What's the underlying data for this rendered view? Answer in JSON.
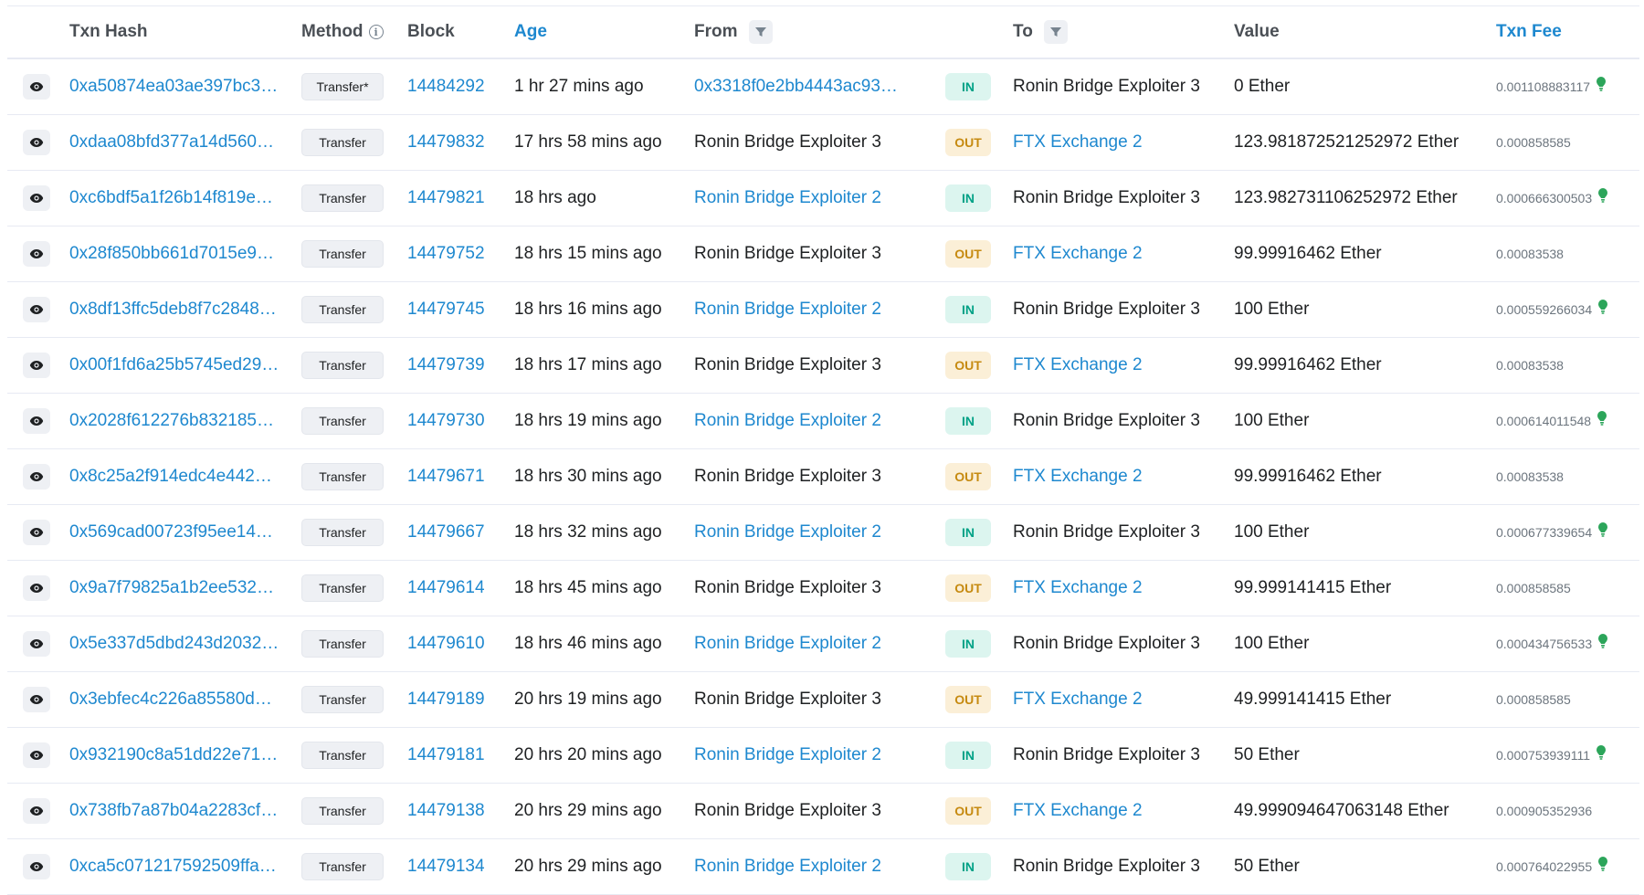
{
  "header": {
    "txn_hash": "Txn Hash",
    "method": "Method",
    "block": "Block",
    "age": "Age",
    "from": "From",
    "to": "To",
    "value": "Value",
    "txn_fee": "Txn Fee"
  },
  "colors": {
    "link": "#1e88cf",
    "in_badge_bg": "#dcf5ef",
    "in_badge_text": "#00a186",
    "out_badge_bg": "#fbefd7",
    "out_badge_text": "#c68a10",
    "fee_icon": "#2ca55a"
  },
  "rows": [
    {
      "hash": "0xa50874ea03ae397bc3…",
      "method": "Transfer*",
      "block": "14484292",
      "age": "1 hr 27 mins ago",
      "from": "0x3318f0e2bb4443ac93…",
      "from_link": true,
      "dir": "IN",
      "to": "Ronin Bridge Exploiter 3",
      "to_link": false,
      "value": "0 Ether",
      "fee": "0.001108883117",
      "fee_icon": true
    },
    {
      "hash": "0xdaa08bfd377a14d560…",
      "method": "Transfer",
      "block": "14479832",
      "age": "17 hrs 58 mins ago",
      "from": "Ronin Bridge Exploiter 3",
      "from_link": false,
      "dir": "OUT",
      "to": "FTX Exchange 2",
      "to_link": true,
      "value": "123.981872521252972 Ether",
      "fee": "0.000858585",
      "fee_icon": false
    },
    {
      "hash": "0xc6bdf5a1f26b14f819e…",
      "method": "Transfer",
      "block": "14479821",
      "age": "18 hrs ago",
      "from": "Ronin Bridge Exploiter 2",
      "from_link": true,
      "dir": "IN",
      "to": "Ronin Bridge Exploiter 3",
      "to_link": false,
      "value": "123.982731106252972 Ether",
      "fee": "0.000666300503",
      "fee_icon": true
    },
    {
      "hash": "0x28f850bb661d7015e9…",
      "method": "Transfer",
      "block": "14479752",
      "age": "18 hrs 15 mins ago",
      "from": "Ronin Bridge Exploiter 3",
      "from_link": false,
      "dir": "OUT",
      "to": "FTX Exchange 2",
      "to_link": true,
      "value": "99.99916462 Ether",
      "fee": "0.00083538",
      "fee_icon": false
    },
    {
      "hash": "0x8df13ffc5deb8f7c2848…",
      "method": "Transfer",
      "block": "14479745",
      "age": "18 hrs 16 mins ago",
      "from": "Ronin Bridge Exploiter 2",
      "from_link": true,
      "dir": "IN",
      "to": "Ronin Bridge Exploiter 3",
      "to_link": false,
      "value": "100 Ether",
      "fee": "0.000559266034",
      "fee_icon": true
    },
    {
      "hash": "0x00f1fd6a25b5745ed29…",
      "method": "Transfer",
      "block": "14479739",
      "age": "18 hrs 17 mins ago",
      "from": "Ronin Bridge Exploiter 3",
      "from_link": false,
      "dir": "OUT",
      "to": "FTX Exchange 2",
      "to_link": true,
      "value": "99.99916462 Ether",
      "fee": "0.00083538",
      "fee_icon": false
    },
    {
      "hash": "0x2028f612276b832185…",
      "method": "Transfer",
      "block": "14479730",
      "age": "18 hrs 19 mins ago",
      "from": "Ronin Bridge Exploiter 2",
      "from_link": true,
      "dir": "IN",
      "to": "Ronin Bridge Exploiter 3",
      "to_link": false,
      "value": "100 Ether",
      "fee": "0.000614011548",
      "fee_icon": true
    },
    {
      "hash": "0x8c25a2f914edc4e442…",
      "method": "Transfer",
      "block": "14479671",
      "age": "18 hrs 30 mins ago",
      "from": "Ronin Bridge Exploiter 3",
      "from_link": false,
      "dir": "OUT",
      "to": "FTX Exchange 2",
      "to_link": true,
      "value": "99.99916462 Ether",
      "fee": "0.00083538",
      "fee_icon": false
    },
    {
      "hash": "0x569cad00723f95ee14…",
      "method": "Transfer",
      "block": "14479667",
      "age": "18 hrs 32 mins ago",
      "from": "Ronin Bridge Exploiter 2",
      "from_link": true,
      "dir": "IN",
      "to": "Ronin Bridge Exploiter 3",
      "to_link": false,
      "value": "100 Ether",
      "fee": "0.000677339654",
      "fee_icon": true
    },
    {
      "hash": "0x9a7f79825a1b2ee532…",
      "method": "Transfer",
      "block": "14479614",
      "age": "18 hrs 45 mins ago",
      "from": "Ronin Bridge Exploiter 3",
      "from_link": false,
      "dir": "OUT",
      "to": "FTX Exchange 2",
      "to_link": true,
      "value": "99.999141415 Ether",
      "fee": "0.000858585",
      "fee_icon": false
    },
    {
      "hash": "0x5e337d5dbd243d2032…",
      "method": "Transfer",
      "block": "14479610",
      "age": "18 hrs 46 mins ago",
      "from": "Ronin Bridge Exploiter 2",
      "from_link": true,
      "dir": "IN",
      "to": "Ronin Bridge Exploiter 3",
      "to_link": false,
      "value": "100 Ether",
      "fee": "0.000434756533",
      "fee_icon": true
    },
    {
      "hash": "0x3ebfec4c226a85580d…",
      "method": "Transfer",
      "block": "14479189",
      "age": "20 hrs 19 mins ago",
      "from": "Ronin Bridge Exploiter 3",
      "from_link": false,
      "dir": "OUT",
      "to": "FTX Exchange 2",
      "to_link": true,
      "value": "49.999141415 Ether",
      "fee": "0.000858585",
      "fee_icon": false
    },
    {
      "hash": "0x932190c8a51dd22e71…",
      "method": "Transfer",
      "block": "14479181",
      "age": "20 hrs 20 mins ago",
      "from": "Ronin Bridge Exploiter 2",
      "from_link": true,
      "dir": "IN",
      "to": "Ronin Bridge Exploiter 3",
      "to_link": false,
      "value": "50 Ether",
      "fee": "0.000753939111",
      "fee_icon": true
    },
    {
      "hash": "0x738fb7a87b04a2283cf…",
      "method": "Transfer",
      "block": "14479138",
      "age": "20 hrs 29 mins ago",
      "from": "Ronin Bridge Exploiter 3",
      "from_link": false,
      "dir": "OUT",
      "to": "FTX Exchange 2",
      "to_link": true,
      "value": "49.999094647063148 Ether",
      "fee": "0.000905352936",
      "fee_icon": false
    },
    {
      "hash": "0xca5c071217592509ffa…",
      "method": "Transfer",
      "block": "14479134",
      "age": "20 hrs 29 mins ago",
      "from": "Ronin Bridge Exploiter 2",
      "from_link": true,
      "dir": "IN",
      "to": "Ronin Bridge Exploiter 3",
      "to_link": false,
      "value": "50 Ether",
      "fee": "0.000764022955",
      "fee_icon": true
    }
  ]
}
